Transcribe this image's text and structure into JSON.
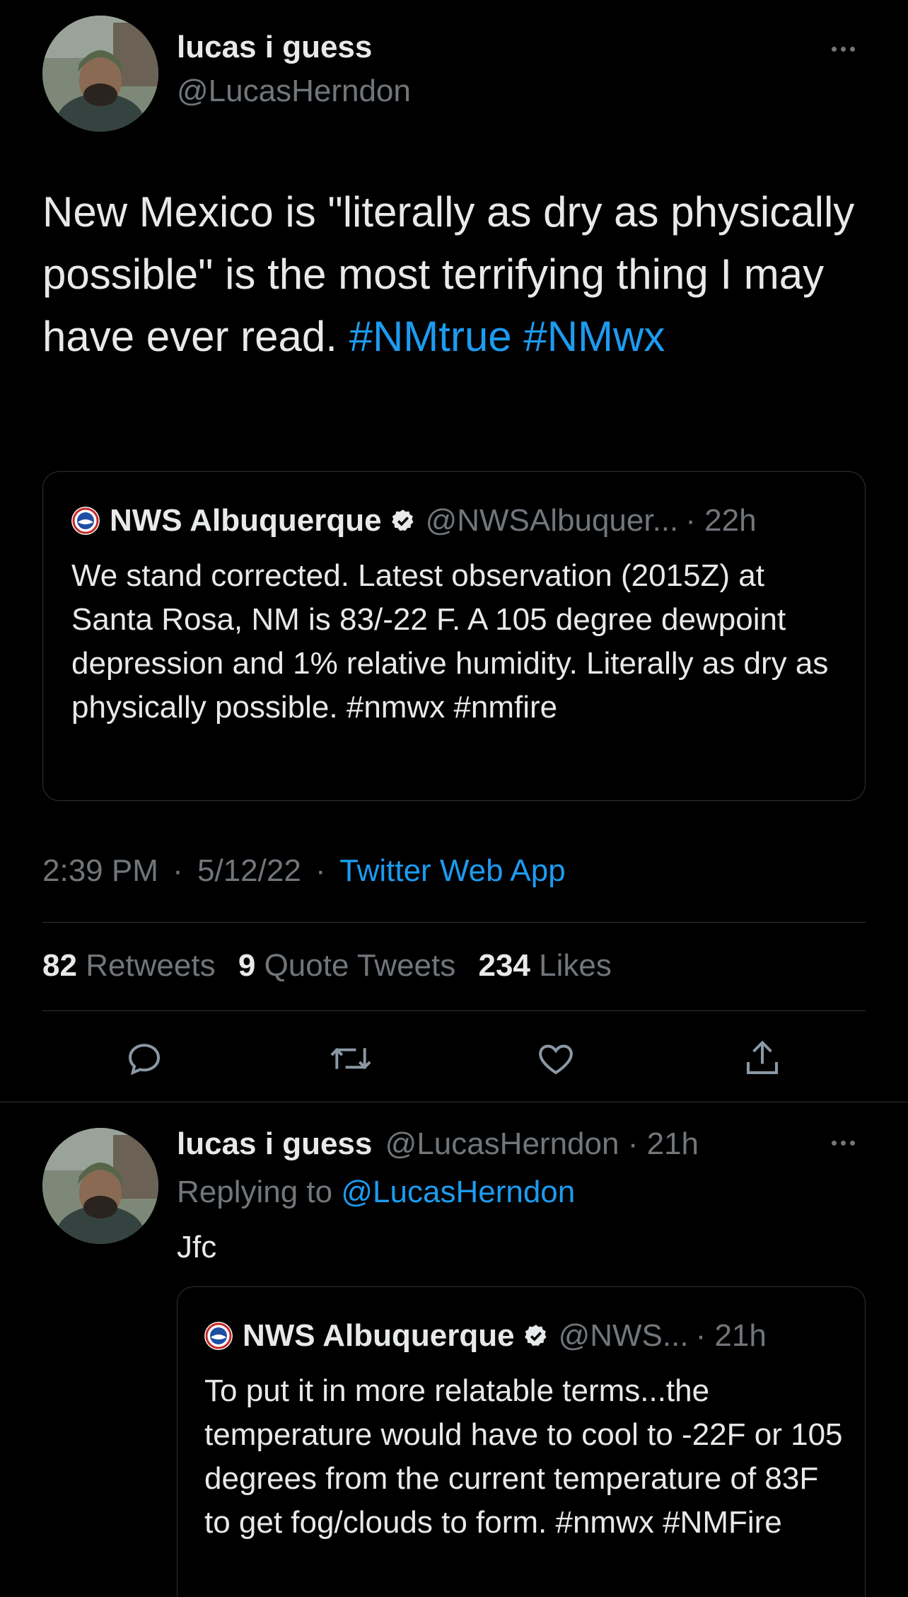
{
  "tweet": {
    "display_name": "lucas i guess",
    "handle": "@LucasHerndon",
    "text": "New Mexico is \"literally as dry as physically possible\" is the most terrifying thing I may have ever read.",
    "hashtags": [
      "#NMtrue",
      "#NMwx"
    ],
    "quote": {
      "display_name": "NWS Albuquerque",
      "handle": "@NWSAlbuquer...",
      "time": "· 22h",
      "text": "We stand corrected. Latest observation (2015Z) at Santa Rosa, NM is 83/-22 F. A 105 degree dewpoint depression and 1% relative humidity. Literally as dry as physically possible. #nmwx #nmfire"
    },
    "meta": {
      "time": "2:39 PM",
      "date": "5/12/22",
      "source": "Twitter Web App",
      "sep": "·"
    },
    "stats": {
      "retweets_count": "82",
      "retweets_label": "Retweets",
      "quotes_count": "9",
      "quotes_label": "Quote Tweets",
      "likes_count": "234",
      "likes_label": "Likes"
    }
  },
  "reply": {
    "display_name": "lucas i guess",
    "handle": "@LucasHerndon",
    "time": "· 21h",
    "replying_to_label": "Replying to",
    "replying_to_handle": "@LucasHerndon",
    "text": "Jfc",
    "quote": {
      "display_name": "NWS Albuquerque",
      "handle": "@NWS...",
      "time": "· 21h",
      "text": "To put it in more relatable terms...the temperature would have to cool to -22F or 105 degrees from the current temperature of 83F to get fog/clouds to form. #nmwx #NMFire"
    }
  },
  "icons": [
    "more-icon",
    "reply-icon",
    "retweet-icon",
    "like-icon",
    "share-icon",
    "verified-badge-icon",
    "nws-logo-icon"
  ],
  "colors": {
    "background": "#000000",
    "text": "#e7e9ea",
    "muted": "#71767b",
    "link": "#1d9bf0",
    "border": "#2f3336"
  }
}
